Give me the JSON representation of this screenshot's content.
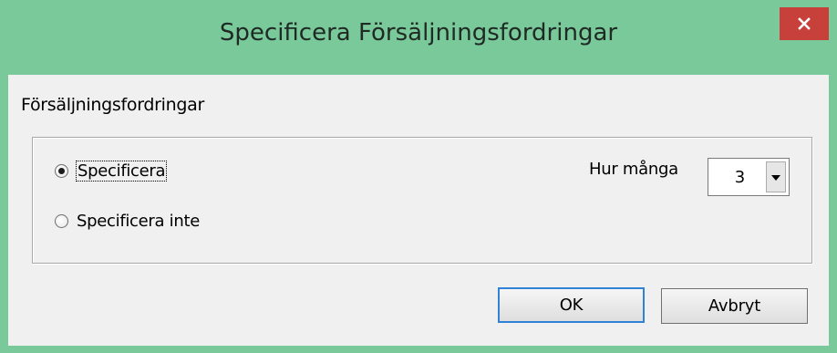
{
  "window": {
    "title": "Specificera Försäljningsfordringar"
  },
  "group": {
    "label": "Försäljningsfordringar",
    "options": [
      {
        "label": "Specificera",
        "selected": true
      },
      {
        "label": "Specificera inte",
        "selected": false
      }
    ]
  },
  "count": {
    "label": "Hur många",
    "value": "3"
  },
  "buttons": {
    "ok_label": "OK",
    "cancel_label": "Avbryt"
  },
  "colors": {
    "title_bar": "#79c99a",
    "close_button": "#c7413a",
    "dialog_background": "#f0f0f0",
    "default_button_border": "#2f82d6"
  },
  "icons": {
    "close": "close-icon",
    "dropdown": "chevron-down-icon"
  }
}
